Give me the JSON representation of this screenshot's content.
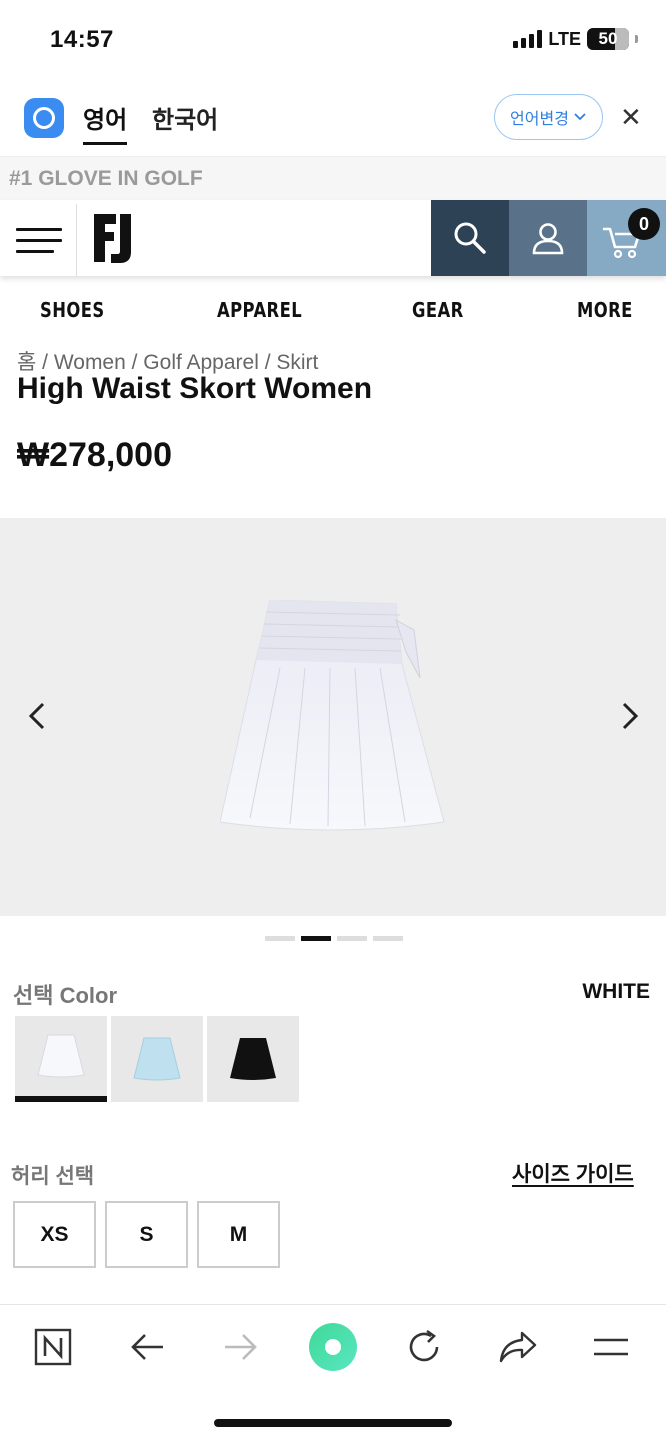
{
  "status_bar": {
    "time": "14:57",
    "network": "LTE",
    "battery": "50"
  },
  "translate_bar": {
    "active_language": "영어",
    "other_language": "한국어",
    "change_button": "언어변경",
    "close_icon": "close-icon"
  },
  "promo": {
    "text": "#1 GLOVE IN GOLF"
  },
  "header": {
    "logo_icon": "fj-logo",
    "menu_icon": "hamburger-icon",
    "search_icon": "search-icon",
    "account_icon": "user-icon",
    "cart_icon": "cart-icon",
    "cart_count": "0",
    "colors": {
      "search_bg": "#2e4256",
      "account_bg": "#5a7289",
      "cart_bg": "#86a9c4"
    }
  },
  "nav": {
    "items": [
      "SHOES",
      "APPAREL",
      "GEAR",
      "MORE"
    ]
  },
  "product": {
    "breadcrumb": "홈 / Women / Golf Apparel / Skirt",
    "title": "High Waist Skort Women",
    "price": "₩278,000",
    "gallery": {
      "total_images": 4,
      "active_index": 1
    }
  },
  "color": {
    "label": "선택 Color",
    "selected": "WHITE",
    "swatches": [
      {
        "name": "white",
        "hex": "#f4f5fa"
      },
      {
        "name": "light blue",
        "hex": "#bfe0ee"
      },
      {
        "name": "black",
        "hex": "#111111"
      }
    ]
  },
  "size": {
    "label": "허리 선택",
    "guide_link": "사이즈 가이드",
    "options": [
      "XS",
      "S",
      "M"
    ]
  },
  "browser_toolbar": {
    "icons": [
      "naver-n-icon",
      "back-arrow-icon",
      "forward-arrow-icon",
      "green-dot-icon",
      "reload-icon",
      "share-icon",
      "menu-icon"
    ],
    "accent": "#3fd999"
  }
}
